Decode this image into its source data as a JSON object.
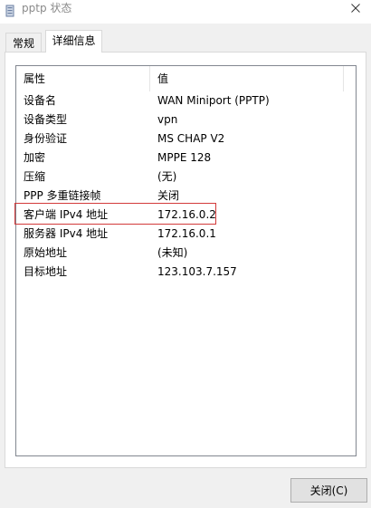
{
  "window": {
    "title": "pptp 状态",
    "icon": "network-connection-icon",
    "close_glyph": "✕"
  },
  "tabs": [
    {
      "label": "常规",
      "active": false
    },
    {
      "label": "详细信息",
      "active": true
    }
  ],
  "details": {
    "columns": [
      "属性",
      "值"
    ],
    "rows": [
      {
        "property": "设备名",
        "value": "WAN Miniport (PPTP)"
      },
      {
        "property": "设备类型",
        "value": "vpn"
      },
      {
        "property": "身份验证",
        "value": "MS CHAP V2"
      },
      {
        "property": "加密",
        "value": "MPPE 128"
      },
      {
        "property": "压缩",
        "value": "(无)"
      },
      {
        "property": "PPP 多重链接帧",
        "value": "关闭"
      },
      {
        "property": "客户端 IPv4 地址",
        "value": "172.16.0.2"
      },
      {
        "property": "服务器 IPv4 地址",
        "value": "172.16.0.1"
      },
      {
        "property": "原始地址",
        "value": "(未知)"
      },
      {
        "property": "目标地址",
        "value": "123.103.7.157"
      }
    ],
    "highlighted_row": 6
  },
  "buttons": {
    "close_label": "关闭(C)"
  },
  "colors": {
    "highlight_border": "#d33a3a",
    "title_text": "#8a8a8a"
  }
}
